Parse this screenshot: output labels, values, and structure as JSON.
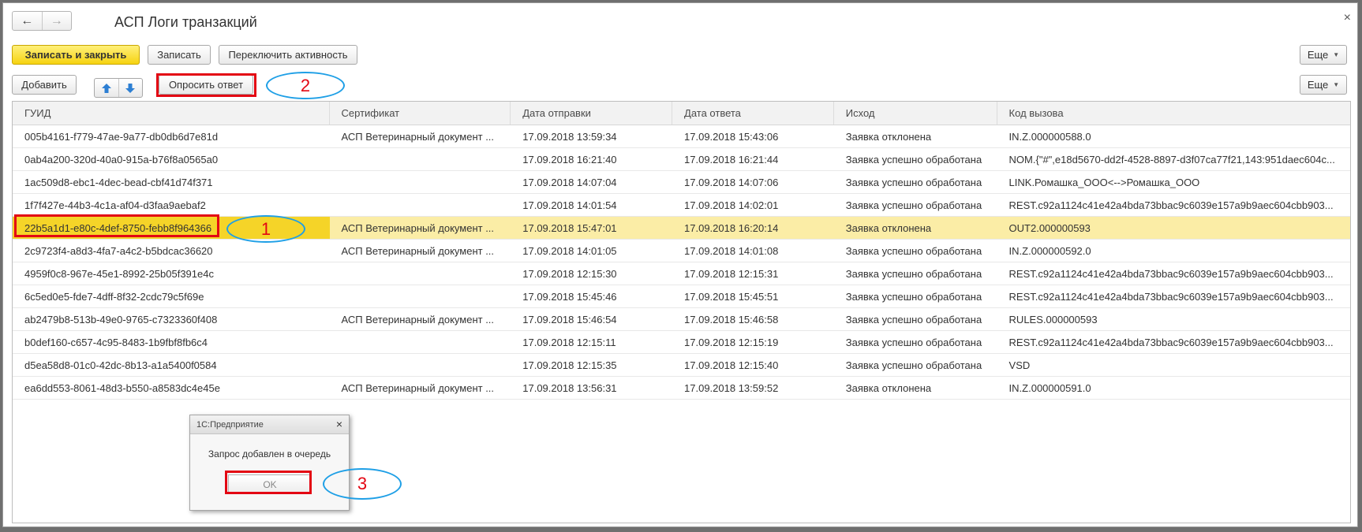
{
  "window": {
    "title": "АСП Логи транзакций"
  },
  "nav": {
    "back": "←",
    "forward": "→",
    "close": "×"
  },
  "toolbar1": {
    "save_close": "Записать и закрыть",
    "save": "Записать",
    "toggle_activity": "Переключить активность",
    "more": "Еще"
  },
  "toolbar2": {
    "add": "Добавить",
    "up": "↑",
    "down": "↓",
    "request_answer": "Опросить ответ",
    "more": "Еще"
  },
  "table": {
    "columns": [
      "ГУИД",
      "Сертификат",
      "Дата отправки",
      "Дата ответа",
      "Исход",
      "Код вызова"
    ],
    "rows": [
      [
        "005b4161-f779-47ae-9a77-db0db6d7e81d",
        "АСП Ветеринарный документ ...",
        "17.09.2018 13:59:34",
        "17.09.2018 15:43:06",
        "Заявка отклонена",
        "IN.Z.000000588.0"
      ],
      [
        "0ab4a200-320d-40a0-915a-b76f8a0565a0",
        "",
        "17.09.2018 16:21:40",
        "17.09.2018 16:21:44",
        "Заявка успешно обработана",
        "NOM.{\"#\",e18d5670-dd2f-4528-8897-d3f07ca77f21,143:951daec604c..."
      ],
      [
        "1ac509d8-ebc1-4dec-bead-cbf41d74f371",
        "",
        "17.09.2018 14:07:04",
        "17.09.2018 14:07:06",
        "Заявка успешно обработана",
        "LINK.Ромашка_ООО<-->Ромашка_ООО"
      ],
      [
        "1f7f427e-44b3-4c1a-af04-d3faa9aebaf2",
        "",
        "17.09.2018 14:01:54",
        "17.09.2018 14:02:01",
        "Заявка успешно обработана",
        "REST.c92a1124c41e42a4bda73bbac9c6039e157a9b9aec604cbb903..."
      ],
      [
        "22b5a1d1-e80c-4def-8750-febb8f964366",
        "АСП Ветеринарный документ ...",
        "17.09.2018 15:47:01",
        "17.09.2018 16:20:14",
        "Заявка отклонена",
        "OUT2.000000593"
      ],
      [
        "2c9723f4-a8d3-4fa7-a4c2-b5bdcac36620",
        "АСП Ветеринарный документ ...",
        "17.09.2018 14:01:05",
        "17.09.2018 14:01:08",
        "Заявка успешно обработана",
        "IN.Z.000000592.0"
      ],
      [
        "4959f0c8-967e-45e1-8992-25b05f391e4c",
        "",
        "17.09.2018 12:15:30",
        "17.09.2018 12:15:31",
        "Заявка успешно обработана",
        "REST.c92a1124c41e42a4bda73bbac9c6039e157a9b9aec604cbb903..."
      ],
      [
        "6c5ed0e5-fde7-4dff-8f32-2cdc79c5f69e",
        "",
        "17.09.2018 15:45:46",
        "17.09.2018 15:45:51",
        "Заявка успешно обработана",
        "REST.c92a1124c41e42a4bda73bbac9c6039e157a9b9aec604cbb903..."
      ],
      [
        "ab2479b8-513b-49e0-9765-c7323360f408",
        "АСП Ветеринарный документ ...",
        "17.09.2018 15:46:54",
        "17.09.2018 15:46:58",
        "Заявка успешно обработана",
        "RULES.000000593"
      ],
      [
        "b0def160-c657-4c95-8483-1b9fbf8fb6c4",
        "",
        "17.09.2018 12:15:11",
        "17.09.2018 12:15:19",
        "Заявка успешно обработана",
        "REST.c92a1124c41e42a4bda73bbac9c6039e157a9b9aec604cbb903..."
      ],
      [
        "d5ea58d8-01c0-42dc-8b13-a1a5400f0584",
        "",
        "17.09.2018 12:15:35",
        "17.09.2018 12:15:40",
        "Заявка успешно обработана",
        "VSD"
      ],
      [
        "ea6dd553-8061-48d3-b550-a8583dc4e45e",
        "АСП Ветеринарный документ ...",
        "17.09.2018 13:56:31",
        "17.09.2018 13:59:52",
        "Заявка отклонена",
        "IN.Z.000000591.0"
      ]
    ],
    "selected_row": 4
  },
  "dialog": {
    "title": "1С:Предприятие",
    "message": "Запрос добавлен в очередь",
    "ok": "OK",
    "close": "×"
  },
  "annotations": {
    "a1": "1",
    "a2": "2",
    "a3": "3"
  },
  "colors": {
    "highlight_red": "#e30613",
    "ellipse_blue": "#1e9fe6",
    "primary_yellow": "#f6d311",
    "selected_row": "#fbeda6"
  }
}
